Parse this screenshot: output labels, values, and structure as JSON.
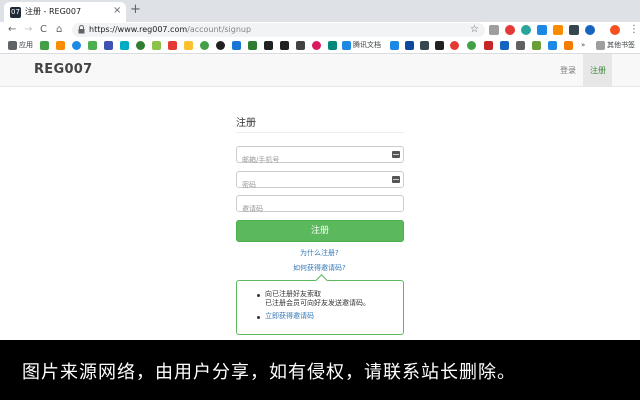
{
  "browser": {
    "tab": {
      "favicon_text": "07",
      "title": "注册 - REG007",
      "close": "×"
    },
    "new_tab": "+",
    "nav": {
      "back": "←",
      "forward": "→",
      "reload": "C",
      "home": "⌂"
    },
    "url": {
      "host": "https://www.reg007.com",
      "path": "/account/signup"
    },
    "star": "☆",
    "menu": "⋮",
    "bookmarks": {
      "apps_label": "应用",
      "tencent_docs": "腾讯文档",
      "more": "»",
      "other": "其他书签"
    }
  },
  "site": {
    "logo": "REG007",
    "nav": {
      "login": "登录",
      "signup": "注册"
    }
  },
  "form": {
    "heading": "注册",
    "email_placeholder": "邮箱/手机号",
    "password_placeholder": "密码",
    "invite_placeholder": "邀请码",
    "submit": "注册",
    "why_link": "为什么注册?",
    "how_link": "如何获得邀请码?"
  },
  "info": {
    "line1": "向已注册好友索取",
    "line2": "已注册会员可向好友发送邀请码。",
    "link": "立即获得邀请码"
  },
  "overlay": {
    "text": "图片来源网络，由用户分享，如有侵权，请联系站长删除。"
  }
}
